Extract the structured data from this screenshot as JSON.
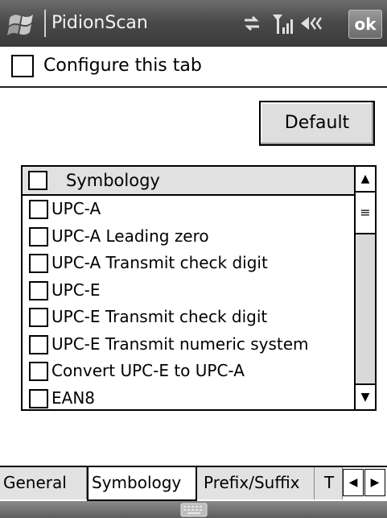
{
  "titlebar": {
    "app_title": "PidionScan",
    "icons": [
      "windows-flag-icon",
      "connectivity-icon",
      "signal-icon",
      "volume-icon"
    ],
    "ok_label": "ok"
  },
  "config": {
    "checkbox_label": "Configure this tab",
    "checked": false
  },
  "default_button_label": "Default",
  "list": {
    "header_label": "Symbology",
    "items": [
      {
        "label": "UPC-A",
        "checked": false
      },
      {
        "label": "UPC-A Leading zero",
        "checked": false
      },
      {
        "label": "UPC-A Transmit check digit",
        "checked": false
      },
      {
        "label": "UPC-E",
        "checked": false
      },
      {
        "label": "UPC-E Transmit check digit",
        "checked": false
      },
      {
        "label": "UPC-E Transmit numeric system",
        "checked": false
      },
      {
        "label": "Convert UPC-E to UPC-A",
        "checked": false
      },
      {
        "label": "EAN8",
        "checked": false
      }
    ]
  },
  "tabs": [
    {
      "label": "General",
      "active": false
    },
    {
      "label": "Symbology",
      "active": true
    },
    {
      "label": "Prefix/Suffix",
      "active": false
    },
    {
      "label": "T",
      "active": false
    }
  ],
  "bottombar": {
    "icon": "keyboard-icon"
  },
  "colors": {
    "titlebar": "#4a4a4a",
    "header": "#e1e1e1",
    "tab": "#e2e2e2"
  }
}
